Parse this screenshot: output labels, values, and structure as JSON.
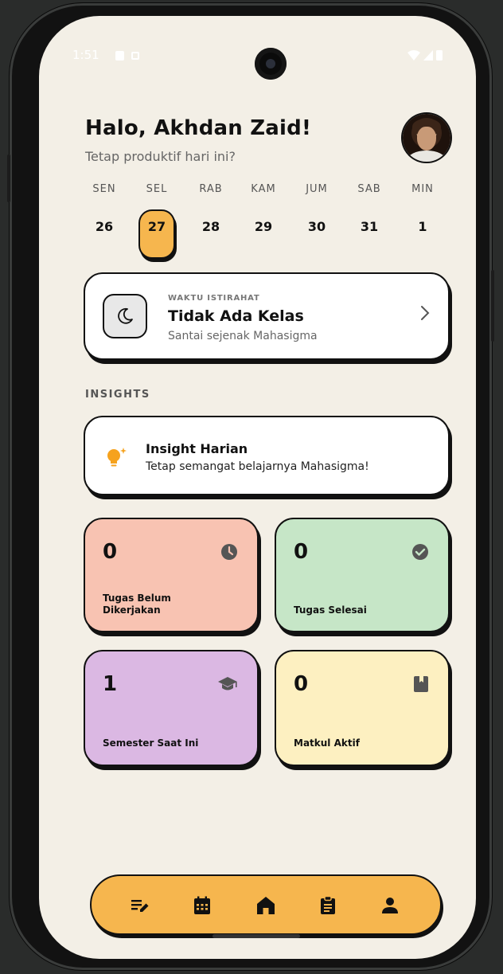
{
  "status_bar": {
    "time": "1:51"
  },
  "header": {
    "greeting": "Halo, Akhdan Zaid!",
    "subtitle": "Tetap produktif hari ini?"
  },
  "week": {
    "days": [
      {
        "name": "SEN",
        "num": "26",
        "active": false
      },
      {
        "name": "SEL",
        "num": "27",
        "active": true
      },
      {
        "name": "RAB",
        "num": "28",
        "active": false
      },
      {
        "name": "KAM",
        "num": "29",
        "active": false
      },
      {
        "name": "JUM",
        "num": "30",
        "active": false
      },
      {
        "name": "SAB",
        "num": "31",
        "active": false
      },
      {
        "name": "MIN",
        "num": "1",
        "active": false
      }
    ],
    "active_color": "#f6b64e"
  },
  "break_card": {
    "kicker": "WAKTU ISTIRAHAT",
    "title": "Tidak Ada Kelas",
    "subtitle": "Santai sejenak Mahasigma",
    "icon": "moon-icon"
  },
  "insights": {
    "section_title": "INSIGHTS",
    "title": "Insight Harian",
    "text": "Tetap semangat belajarnya Mahasigma!",
    "icon": "lightbulb-icon"
  },
  "stats": [
    {
      "value": "0",
      "label_lines": [
        "Tugas Belum",
        "Dikerjakan"
      ],
      "icon": "clock-icon",
      "color": "#f8c3b2"
    },
    {
      "value": "0",
      "label_lines": [
        "Tugas Selesai"
      ],
      "icon": "check-circle-icon",
      "color": "#c6e6c7"
    },
    {
      "value": "1",
      "label_lines": [
        "Semester Saat Ini"
      ],
      "icon": "graduation-cap-icon",
      "color": "#dbb8e3"
    },
    {
      "value": "0",
      "label_lines": [
        "Matkul Aktif"
      ],
      "icon": "book-icon",
      "color": "#fdf0c1"
    }
  ],
  "bottom_nav": {
    "items": [
      "edit-note-icon",
      "calendar-icon",
      "home-icon",
      "clipboard-icon",
      "person-icon"
    ],
    "active": "home-icon",
    "color": "#f6b64e"
  }
}
